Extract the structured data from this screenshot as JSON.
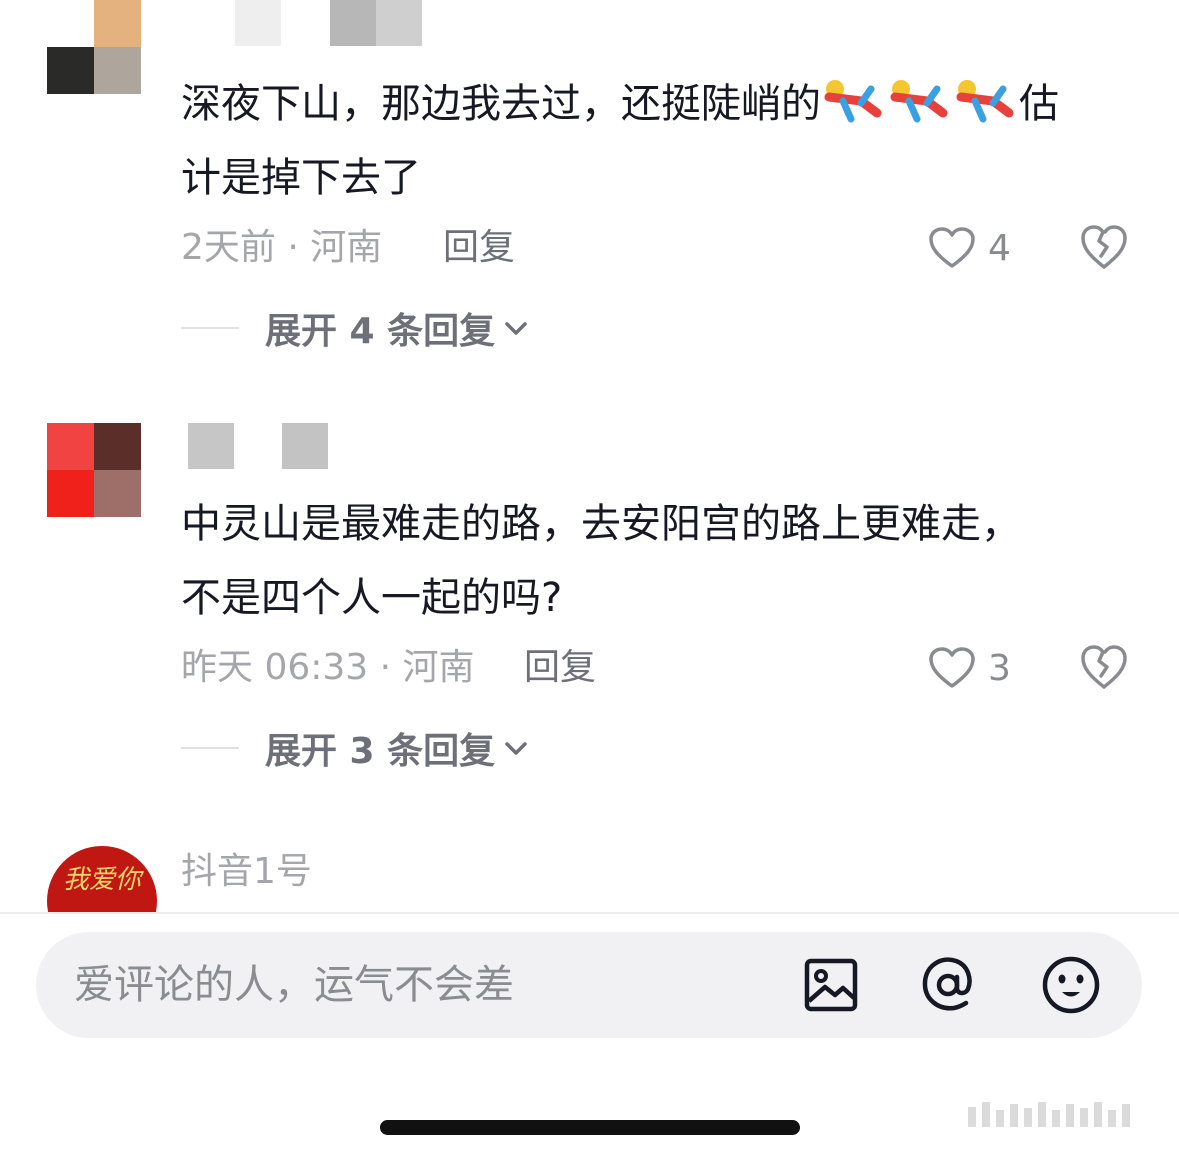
{
  "comments": [
    {
      "text_a": "深夜下山，那边我去过，还挺陡峭的",
      "text_b": "估",
      "text_c": "计是掉下去了",
      "emoji": "running-person-emoji",
      "time": "2天前",
      "location": "· 河南",
      "reply_label": "回复",
      "likes": "4",
      "expand_label": "展开 4 条回复"
    },
    {
      "text_a": "中灵山是最难走的路，去安阳宫的路上更难走，",
      "text_b": "不是四个人一起的吗?",
      "time": "昨天 06:33",
      "location": "· 河南",
      "reply_label": "回复",
      "likes": "3",
      "expand_label": "展开 3 条回复"
    },
    {
      "username": "抖音1号",
      "avatar_text": "我爱你"
    }
  ],
  "input": {
    "placeholder": "爱评论的人，运气不会差"
  },
  "icons": {
    "image": "image-icon",
    "at": "at-icon",
    "emoji": "smiley-icon",
    "like": "heart-icon",
    "dislike": "broken-heart-icon",
    "expand": "chevron-down-icon"
  },
  "colors": {
    "primary_text": "#161823",
    "secondary_text": "#a5a6ab",
    "action_text": "#6e7079",
    "input_bg": "#f1f1f3"
  }
}
